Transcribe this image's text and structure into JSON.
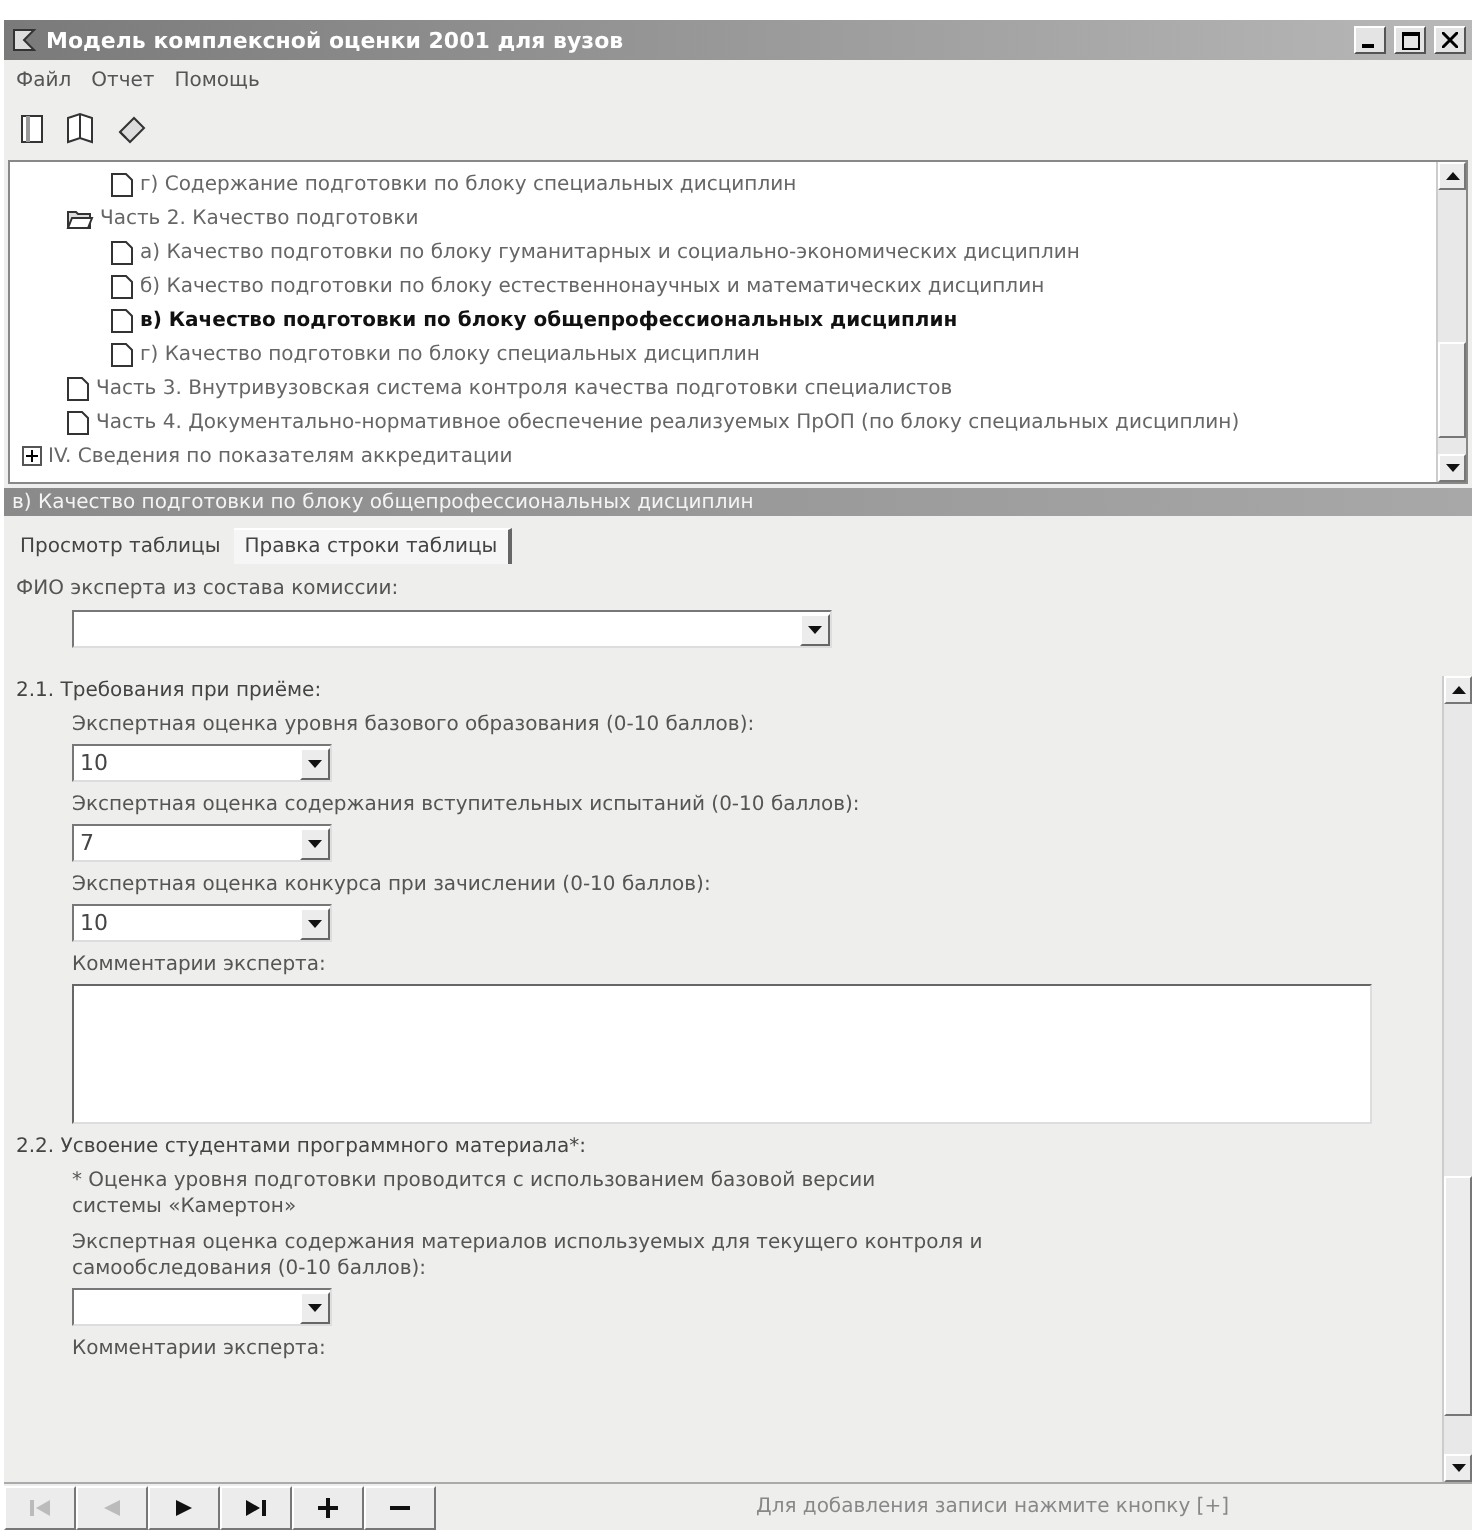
{
  "window": {
    "title": "Модель комплексной оценки 2001 для вузов"
  },
  "menu": [
    "Файл",
    "Отчет",
    "Помощь"
  ],
  "toolbar": [
    {
      "kind": "page"
    },
    {
      "kind": "book"
    },
    {
      "kind": "eraser"
    }
  ],
  "tree": {
    "items": [
      {
        "children": [
          {
            "children": [
              {
                "label": "г) Содержание подготовки по блоку специальных дисциплин",
                "selected": false
              }
            ]
          },
          {
            "label": "Часть 2. Качество подготовки",
            "expanded": true,
            "selected": false,
            "children": [
              {
                "label": "а) Качество подготовки по блоку гуманитарных и социально-экономических дисциплин",
                "selected": false
              },
              {
                "label": "б) Качество подготовки по блоку естественнонаучных и математических дисциплин",
                "selected": false
              },
              {
                "label": "в) Качество подготовки по блоку общепрофессиональных дисциплин",
                "selected": true
              },
              {
                "label": "г) Качество подготовки по блоку специальных дисциплин",
                "selected": false
              }
            ]
          },
          {
            "label": "Часть 3. Внутривузовская система контроля качества подготовки специалистов",
            "selected": false
          },
          {
            "label": "Часть 4. Документально-нормативное обеспечение реализуемых ПрОП (по блоку специальных дисциплин)",
            "selected": false
          }
        ]
      },
      {
        "label": "IV. Сведения по показателям аккредитации",
        "expanded": false,
        "selected": false
      }
    ]
  },
  "caption": "в) Качество подготовки по блоку общепрофессиональных дисциплин",
  "tabs": [
    {
      "label": "Просмотр таблицы",
      "selected": false
    },
    {
      "label": "Правка строки таблицы",
      "selected": true
    }
  ],
  "expert": {
    "label": "ФИО эксперта из состава комиссии:"
  },
  "sections": [
    {
      "title": "2.1. Требования при приёме:",
      "items": [
        {
          "kind": "select",
          "label": "Экспертная оценка уровня базового образования (0-10 баллов):",
          "value": "10"
        },
        {
          "kind": "select",
          "label": "Экспертная оценка содержания вступительных испытаний (0-10 баллов):",
          "value": "7"
        },
        {
          "kind": "select",
          "label": "Экспертная оценка конкурса при зачислении (0-10 баллов):",
          "value": "10"
        },
        {
          "kind": "textarea",
          "label": "Комментарии эксперта:",
          "value": ""
        }
      ]
    },
    {
      "title": "2.2. Усвоение студентами программного материала*:",
      "items": [
        {
          "kind": "note",
          "label": "* Оценка уровня подготовки проводится с использованием базовой версии системы «Камертон»"
        },
        {
          "kind": "select",
          "label": "Экспертная оценка содержания материалов используемых для текущего контроля и самообследования (0-10 баллов):"
        },
        {
          "kind": "label",
          "label": "Комментарии эксперта:"
        }
      ]
    }
  ],
  "nav": [
    {
      "kind": "first",
      "disabled": true
    },
    {
      "kind": "prev",
      "disabled": true
    },
    {
      "kind": "next",
      "disabled": false
    },
    {
      "kind": "last",
      "disabled": false
    },
    {
      "kind": "add",
      "disabled": false
    },
    {
      "kind": "delete",
      "disabled": false
    }
  ],
  "status": "Для добавления записи нажмите кнопку [+]"
}
